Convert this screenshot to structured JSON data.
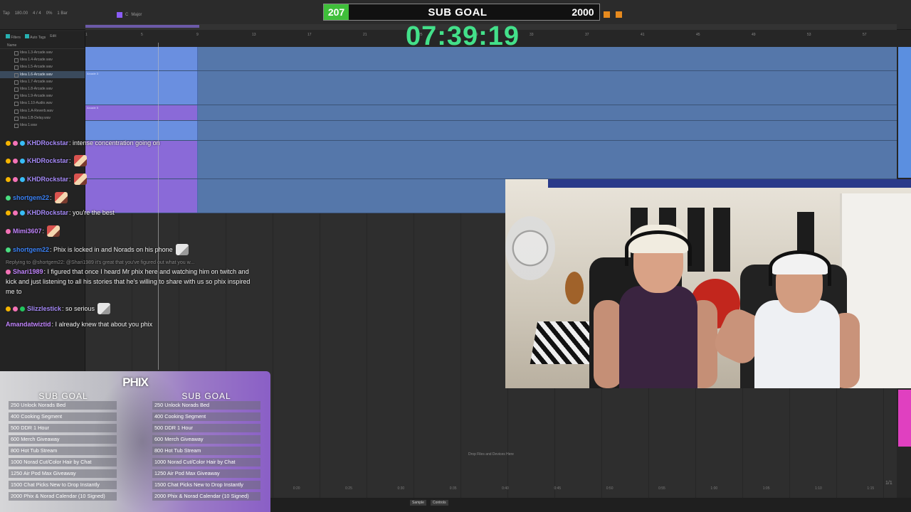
{
  "daw": {
    "transport": [
      "Tap",
      "180.00",
      "4 / 4",
      "0%",
      "1 Bar"
    ],
    "scale_key": "C",
    "scale_mode": "Major",
    "clip_name": "Idea 1",
    "browser_header": [
      "Filters",
      "Auto Tags",
      "Edit"
    ],
    "browser_column": "Name",
    "files": [
      "Idea 1.3-Arcade.wav",
      "Idea 1.4-Arcade.wav",
      "Idea 1.5-Arcade.wav",
      "Idea 1.6-Arcade.wav",
      "Idea 1.7-Arcade.wav",
      "Idea 1.8-Arcade.wav",
      "Idea 1.9-Arcade.wav",
      "Idea 1.10-Audio.wav",
      "Idea 1.A-Reverb.wav",
      "Idea 1.B-Delay.wav",
      "Idea 1.wav"
    ],
    "selected_file_index": 3,
    "ruler_numbers": [
      "1",
      "5",
      "9",
      "13",
      "17",
      "21",
      "25",
      "29",
      "33",
      "37",
      "41",
      "45",
      "49",
      "53",
      "57"
    ],
    "clip_labels": [
      "Arcade 3",
      "Arcade 5"
    ],
    "drop_hint": "Drop Files and Devices Here",
    "bottom_ruler": [
      "0:20",
      "0:25",
      "0:30",
      "0:35",
      "0:40",
      "0:45",
      "0:50",
      "0:55",
      "1:00",
      "1:05",
      "1:10",
      "1:15"
    ],
    "bottom_tabs": [
      "Sample",
      "Controls"
    ],
    "page_indicator": "1/1"
  },
  "subgoal_bar": {
    "current": "207",
    "label": "SUB GOAL",
    "target": "2000",
    "progress_fraction": 0.1035
  },
  "timer": "07:39:19",
  "chat": [
    {
      "badges": [
        "gold",
        "pink",
        "cyan"
      ],
      "user": "KHDRockstar",
      "text": ": intense concentration going on",
      "emote": false
    },
    {
      "badges": [
        "gold",
        "pink",
        "cyan"
      ],
      "user": "KHDRockstar",
      "text": ":",
      "emote": true
    },
    {
      "badges": [
        "gold",
        "pink",
        "cyan"
      ],
      "user": "KHDRockstar",
      "text": ":",
      "emote": true
    },
    {
      "badges": [
        "green"
      ],
      "user": "shortgem22",
      "text": ":",
      "emote": true
    },
    {
      "badges": [
        "gold",
        "pink",
        "cyan"
      ],
      "user": "KHDRockstar",
      "text": ": you're the best",
      "emote": false
    },
    {
      "badges": [
        "pink"
      ],
      "user": "Mimi3607",
      "text": ":",
      "emote": true
    },
    {
      "badges": [
        "green"
      ],
      "user": "shortgem22",
      "text": ": Phix is locked in and Norads on his phone",
      "emote": true
    }
  ],
  "reply_note": "Replying to @shortgem22: @Shari1989 it's great that you've figured out what you w...",
  "reply_message": {
    "user": "Shari1989",
    "text": ": I figured that once I heard Mr phix here and watching him on twitch and kick and just listening to all his stories that he's willing to share with us so phix inspired me to"
  },
  "chat_tail": [
    {
      "user": "Slizzlestick",
      "text": ": so serious"
    },
    {
      "user": "Amandatwiztid",
      "text": ": I already knew that about you phix"
    }
  ],
  "goal_panel": {
    "logo": "PHIX",
    "title_left": "SUB GOAL",
    "title_right": "SUB GOAL",
    "goals": [
      "250 Unlock Norads Bed",
      "400 Cooking Segment",
      "500 DDR 1 Hour",
      "600 Merch Giveaway",
      "800 Hot Tub Stream",
      "1000 Norad Cut/Color Hair by Chat",
      "1250 Air Pod Max Giveaway",
      "1500 Chat Picks New to Drop Instantly",
      "2000 Phix & Norad Calendar (10 Signed)"
    ]
  },
  "colors": {
    "timer": "#43e08a",
    "subgoal_current_bg": "#3fbf3a",
    "track_blue": "#5577aa",
    "clip_blue": "#6a8fe0",
    "clip_purple": "#8a6ad8",
    "accent_pink": "#e040c0"
  }
}
